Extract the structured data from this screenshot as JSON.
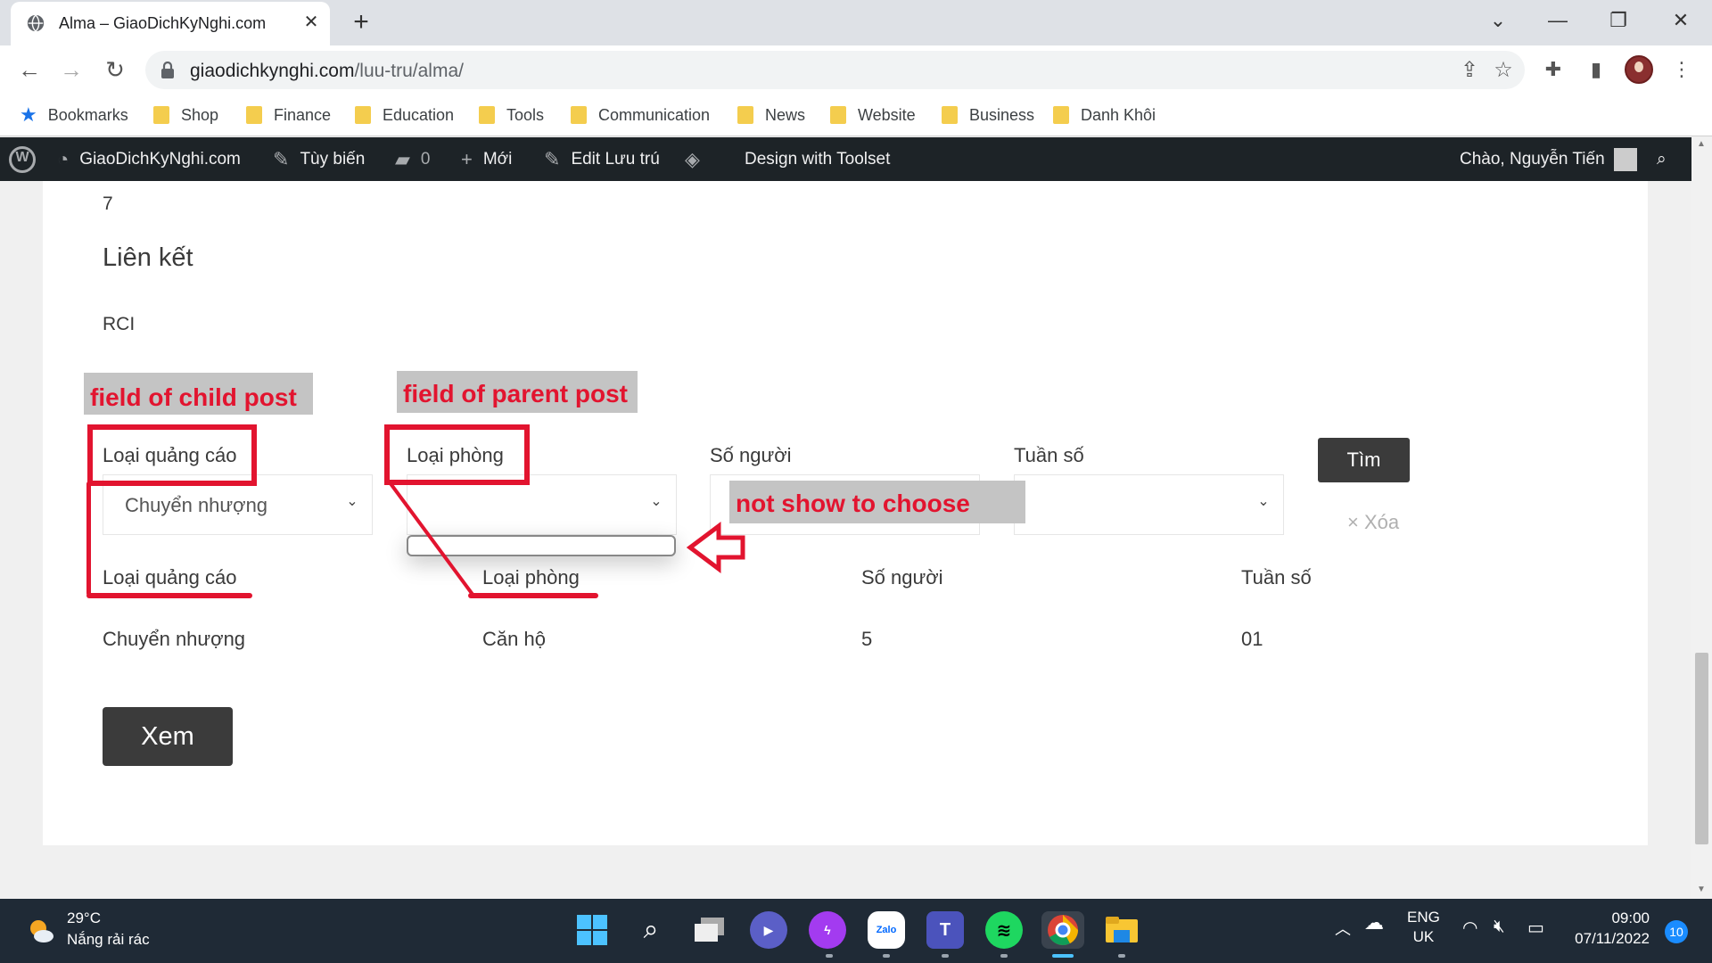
{
  "browser": {
    "tab_title": "Alma – GiaoDichKyNghi.com",
    "url_host": "giaodichkynghi.com",
    "url_path": "/luu-tru/alma/",
    "bookmarks": [
      "Bookmarks",
      "Shop",
      "Finance",
      "Education",
      "Tools",
      "Communication",
      "News",
      "Website",
      "Business",
      "Danh Khôi"
    ]
  },
  "adminbar": {
    "site_name": "GiaoDichKyNghi.com",
    "customize": "Tùy biến",
    "comments_count": "0",
    "new": "Mới",
    "edit": "Edit Lưu trú",
    "toolset": "Design with Toolset",
    "greeting": "Chào, Nguyễn Tiến"
  },
  "page": {
    "number": "7",
    "heading": "Liên kết",
    "affiliate": "RCI",
    "filter": {
      "field1_label": "Loại quảng cáo",
      "field1_value": "Chuyển nhượng",
      "field2_label": "Loại phòng",
      "field2_value": "",
      "field3_label": "Số người",
      "field3_value": "",
      "field4_label": "Tuần số",
      "field4_value": "",
      "search_button": "Tìm",
      "clear_link": "× Xóa"
    },
    "table": {
      "headers": [
        "Loại quảng cáo",
        "Loại phòng",
        "Số người",
        "Tuần số"
      ],
      "row": [
        "Chuyển nhượng",
        "Căn hộ",
        "5",
        "01"
      ]
    },
    "view_button": "Xem"
  },
  "annotations": {
    "child": "field of child post",
    "parent": "field of parent post",
    "note": "not show to choose",
    "color": "#e2142f"
  },
  "taskbar": {
    "temperature": "29°C",
    "weather": "Nắng rải rác",
    "lang1": "ENG",
    "lang2": "UK",
    "time": "09:00",
    "date": "07/11/2022",
    "notifications": "10"
  }
}
